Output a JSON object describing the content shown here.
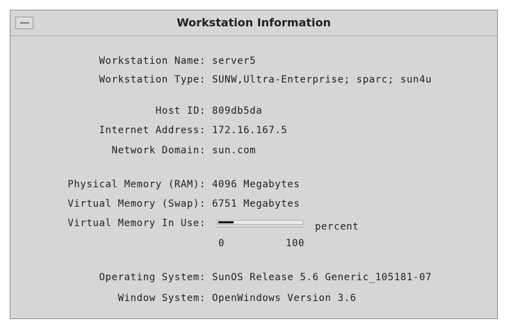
{
  "window": {
    "title": "Workstation Information"
  },
  "rows": {
    "workstation_name": {
      "label": "Workstation Name:",
      "value": "server5"
    },
    "workstation_type": {
      "label": "Workstation Type:",
      "value": "SUNW,Ultra-Enterprise; sparc; sun4u"
    },
    "host_id": {
      "label": "Host ID:",
      "value": "809db5da"
    },
    "internet_address": {
      "label": "Internet Address:",
      "value": "172.16.167.5"
    },
    "network_domain": {
      "label": "Network Domain:",
      "value": "sun.com"
    },
    "physical_memory": {
      "label": "Physical Memory (RAM):",
      "value": "4096 Megabytes"
    },
    "virtual_memory": {
      "label": "Virtual Memory (Swap):",
      "value": "6751 Megabytes"
    },
    "virtual_memory_in_use": {
      "label": "Virtual Memory In Use:"
    },
    "operating_system": {
      "label": "Operating System:",
      "value": "SunOS Release 5.6 Generic_105181-07"
    },
    "window_system": {
      "label": "Window System:",
      "value": "OpenWindows Version 3.6"
    }
  },
  "memory_meter": {
    "percent": 18,
    "min_label": "0",
    "max_label": "100",
    "unit": "percent"
  }
}
